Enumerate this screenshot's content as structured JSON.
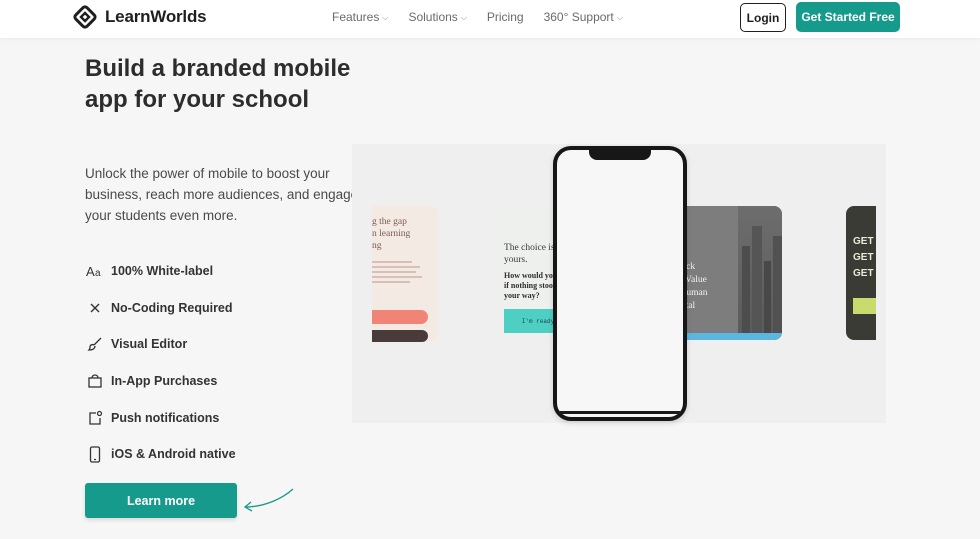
{
  "brand": {
    "name": "LearnWorlds",
    "accent": "#169a8c"
  },
  "nav": {
    "menu": [
      {
        "label": "Features",
        "dropdown": true
      },
      {
        "label": "Solutions",
        "dropdown": true
      },
      {
        "label": "Pricing",
        "dropdown": false
      },
      {
        "label": "360° Support",
        "dropdown": true
      }
    ],
    "login_label": "Login",
    "cta_label": "Get Started Free"
  },
  "hero": {
    "headline": "Build a branded mobile app for your school",
    "subtext": "Unlock the power of mobile to boost your business, reach more audiences, and engage your students even more.",
    "features": [
      {
        "icon": "font-icon",
        "label": "100% White-label"
      },
      {
        "icon": "close-icon",
        "label": "No-Coding Required"
      },
      {
        "icon": "brush-icon",
        "label": "Visual Editor"
      },
      {
        "icon": "shopping-bag-icon",
        "label": "In-App Purchases"
      },
      {
        "icon": "notification-icon",
        "label": "Push notifications"
      },
      {
        "icon": "mobile-icon",
        "label": "iOS & Android native"
      }
    ],
    "learn_more_label": "Learn more"
  },
  "showcase": {
    "card1_text": "g the gap\nn learning\nng",
    "card2_text1": "The choice is\nyours.",
    "card2_text2": "How would you live\nif nothing stood in\nyour way?",
    "card2_cta": "I'm ready to choose",
    "card3_text": "nlock\nne Value\nf Human\napital",
    "card4_text": "GET\nGET\nGET"
  }
}
